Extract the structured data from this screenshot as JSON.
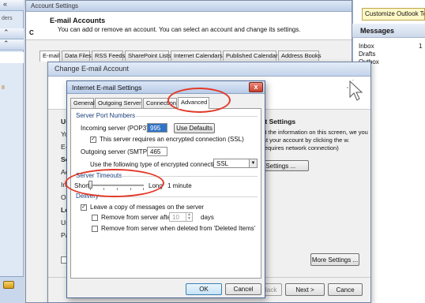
{
  "outlook": {
    "left_strip_items": [
      "",
      "",
      "ders",
      "",
      "",
      "",
      "",
      "8"
    ],
    "customize_label": "Customize Outlook Today",
    "messages_title": "Messages",
    "messages_items": [
      "Inbox",
      "Drafts",
      "Outbox"
    ],
    "inbox_count": "1"
  },
  "account_settings": {
    "title": "Account Settings",
    "heading": "E-mail Accounts",
    "description": "You can add or remove an account. You can select an account and change its settings.",
    "tabs": [
      "E-mail",
      "Data Files",
      "RSS Feeds",
      "SharePoint Lists",
      "Internet Calendars",
      "Published Calendars",
      "Address Books"
    ]
  },
  "change_account": {
    "title": "Change E-mail Account",
    "left_fragments": [
      "Us",
      "Yo",
      "E-",
      "Se",
      "Ac",
      "In",
      "Ou",
      "Lo",
      "Us",
      "Pa"
    ],
    "right_title": "unt Settings",
    "right_text": "out the information on this screen, we you test your account by clicking the w. (Requires network connection)",
    "more_account_btn": "unt Settings ...",
    "more_settings": "More Settings ...",
    "back": "< Back",
    "next": "Next >",
    "cancel": "Cance"
  },
  "inet_dialog": {
    "title": "Internet E-mail Settings",
    "close": "x",
    "tabs": [
      "General",
      "Outgoing Server",
      "Connection",
      "Advanced"
    ],
    "active_tab": "Advanced",
    "server_port_numbers": "Server Port Numbers",
    "incoming_label": "Incoming server (POP3):",
    "incoming_value": "995",
    "use_defaults": "Use Defaults",
    "ssl_checkbox": "This server requires an encrypted connection (SSL)",
    "outgoing_label": "Outgoing server (SMTP):",
    "outgoing_value": "465",
    "encrypt_label": "Use the following type of encrypted connection:",
    "encrypt_value": "SSL",
    "server_timeouts": "Server Timeouts",
    "short": "Short",
    "long": "Long",
    "timeout_value": "1 minute",
    "delivery": "Delivery",
    "leave_copy": "Leave a copy of messages on the server",
    "remove_after": "Remove from server after",
    "remove_days_value": "10",
    "days": "days",
    "remove_deleted": "Remove from server when deleted from 'Deleted Items'",
    "ok": "OK",
    "cancel": "Cancel"
  },
  "colors": {
    "annotation_red": "#e23a2a",
    "selection_blue": "#3173c5"
  }
}
